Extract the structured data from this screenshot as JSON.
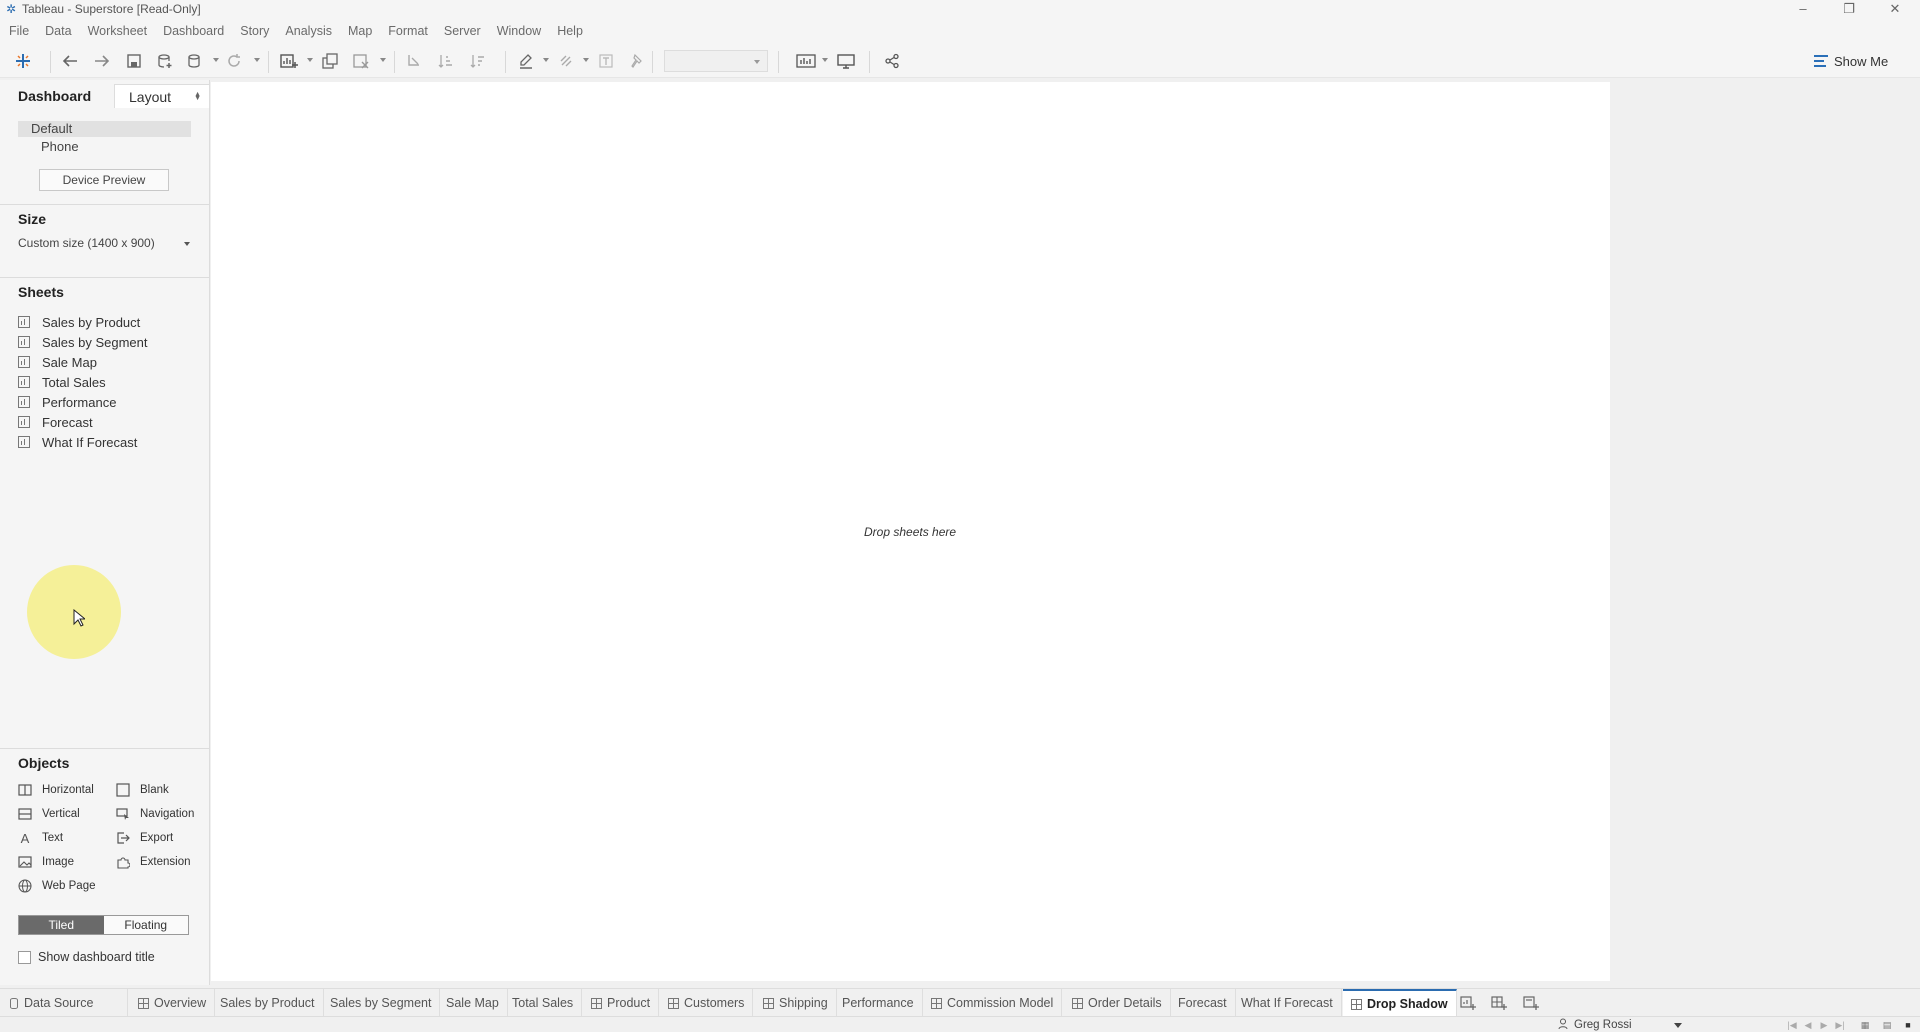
{
  "window": {
    "title": "Tableau - Superstore [Read-Only]"
  },
  "menu": [
    "File",
    "Data",
    "Worksheet",
    "Dashboard",
    "Story",
    "Analysis",
    "Map",
    "Format",
    "Server",
    "Window",
    "Help"
  ],
  "toolbar": {
    "show_me_label": "Show Me",
    "fit_value": ""
  },
  "left_panel": {
    "tab_dashboard": "Dashboard",
    "tab_layout": "Layout",
    "devices": {
      "default": "Default",
      "phone": "Phone",
      "preview_button": "Device Preview"
    },
    "size": {
      "title": "Size",
      "value": "Custom size (1400 x 900)"
    },
    "sheets": {
      "title": "Sheets",
      "items": [
        "Sales by Product",
        "Sales by Segment",
        "Sale Map",
        "Total Sales",
        "Performance",
        "Forecast",
        "What If Forecast"
      ]
    },
    "objects": {
      "title": "Objects",
      "items": {
        "horizontal": "Horizontal",
        "blank": "Blank",
        "vertical": "Vertical",
        "navigation": "Navigation",
        "text": "Text",
        "export": "Export",
        "image": "Image",
        "extension": "Extension",
        "webpage": "Web Page"
      }
    },
    "mode": {
      "tiled": "Tiled",
      "floating": "Floating",
      "selected": "Tiled"
    },
    "show_title_label": "Show dashboard title",
    "show_title_checked": false
  },
  "canvas": {
    "drop_hint": "Drop sheets here"
  },
  "tabs": {
    "data_source": "Data Source",
    "items": [
      "Overview",
      "Sales by Product",
      "Sales by Segment",
      "Sale Map",
      "Total Sales",
      "Product",
      "Customers",
      "Shipping",
      "Performance",
      "Commission Model",
      "Order Details",
      "Forecast",
      "What If Forecast",
      "Drop Shadow"
    ],
    "active": "Drop Shadow"
  },
  "status": {
    "user": "Greg Rossi"
  },
  "colors": {
    "accent": "#2b6cb0",
    "cursor_halo": "#f4ee78",
    "tiled_active": "#6a6a6a"
  }
}
